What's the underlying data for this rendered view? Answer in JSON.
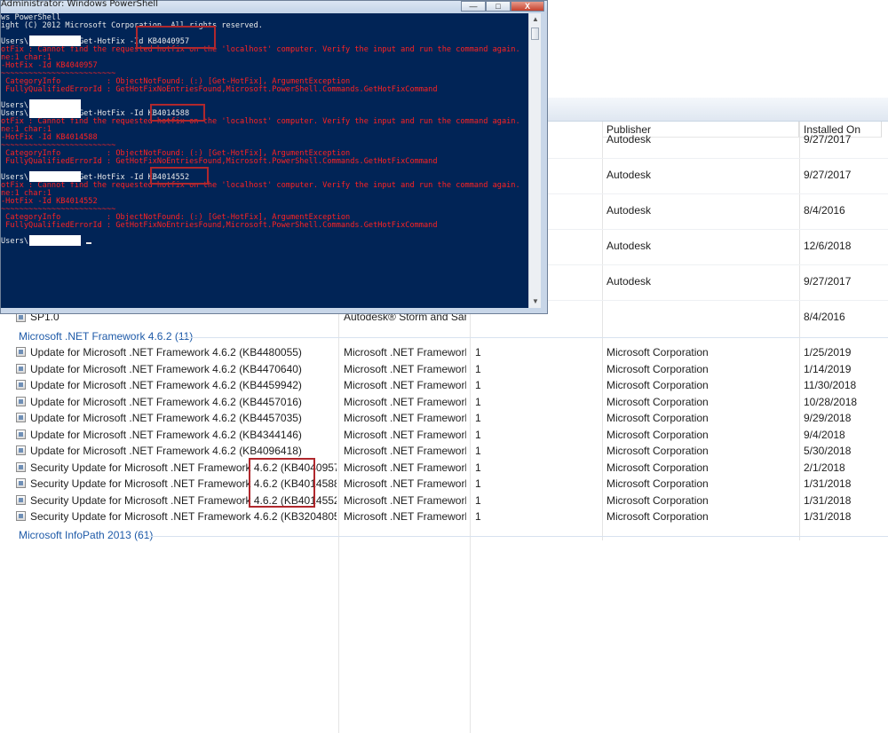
{
  "powershell": {
    "title": "Administrator: Windows PowerShell",
    "min_label": "—",
    "max_label": "□",
    "close_label": "X",
    "lines": [
      {
        "text": "ws PowerShell",
        "color": "w"
      },
      {
        "text": "ight (C) 2012 Microsoft Corporation. All rights reserved.",
        "color": "w"
      },
      {
        "text": "",
        "color": "w"
      },
      {
        "text": "Users\\           Get-HotFix -Id KB4040957",
        "color": "w"
      },
      {
        "text": "otFix : Cannot find the requested hotfix on the 'localhost' computer. Verify the input and run the command again.",
        "color": "r"
      },
      {
        "text": "ne:1 char:1",
        "color": "r"
      },
      {
        "text": "-HotFix -Id KB4040957",
        "color": "r"
      },
      {
        "text": "~~~~~~~~~~~~~~~~~~~~~~~~~",
        "color": "r"
      },
      {
        "text": " CategoryInfo          : ObjectNotFound: (:) [Get-HotFix], ArgumentException",
        "color": "r"
      },
      {
        "text": " FullyQualifiedErrorId : GetHotFixNoEntriesFound,Microsoft.PowerShell.Commands.GetHotFixCommand",
        "color": "r"
      },
      {
        "text": "",
        "color": "w"
      },
      {
        "text": "Users\\",
        "color": "w"
      },
      {
        "text": "Users\\           Get-HotFix -Id KB4014588",
        "color": "w"
      },
      {
        "text": "otFix : Cannot find the requested hotfix on the 'localhost' computer. Verify the input and run the command again.",
        "color": "r"
      },
      {
        "text": "ne:1 char:1",
        "color": "r"
      },
      {
        "text": "-HotFix -Id KB4014588",
        "color": "r"
      },
      {
        "text": "~~~~~~~~~~~~~~~~~~~~~~~~~",
        "color": "r"
      },
      {
        "text": " CategoryInfo          : ObjectNotFound: (:) [Get-HotFix], ArgumentException",
        "color": "r"
      },
      {
        "text": " FullyQualifiedErrorId : GetHotFixNoEntriesFound,Microsoft.PowerShell.Commands.GetHotFixCommand",
        "color": "r"
      },
      {
        "text": "",
        "color": "w"
      },
      {
        "text": "Users\\           Get-HotFix -Id KB4014552",
        "color": "w"
      },
      {
        "text": "otFix : Cannot find the requested hotfix on the 'localhost' computer. Verify the input and run the command again.",
        "color": "r"
      },
      {
        "text": "ne:1 char:1",
        "color": "r"
      },
      {
        "text": "-HotFix -Id KB4014552",
        "color": "r"
      },
      {
        "text": "~~~~~~~~~~~~~~~~~~~~~~~~~",
        "color": "r"
      },
      {
        "text": " CategoryInfo          : ObjectNotFound: (:) [Get-HotFix], ArgumentException",
        "color": "r"
      },
      {
        "text": " FullyQualifiedErrorId : GetHotFixNoEntriesFound,Microsoft.PowerShell.Commands.GetHotFixCommand",
        "color": "r"
      },
      {
        "text": "",
        "color": "w"
      },
      {
        "text": "Users\\",
        "color": "w"
      }
    ]
  },
  "columns": {
    "publisher": "Publisher",
    "installed_on": "Installed On"
  },
  "autodesk_rows": [
    {
      "publisher": "Autodesk",
      "installed_on": "9/27/2017"
    },
    {
      "publisher": "Autodesk",
      "installed_on": "9/27/2017"
    },
    {
      "publisher": "Autodesk",
      "installed_on": "8/4/2016"
    },
    {
      "publisher": "Autodesk",
      "installed_on": "12/6/2018"
    },
    {
      "publisher": "Autodesk",
      "installed_on": "9/27/2017"
    }
  ],
  "sp_row": {
    "name": "SP1.0",
    "program": "Autodesk® Storm and San...",
    "installed_on": "8/4/2016"
  },
  "groups": {
    "net": "Microsoft .NET Framework 4.6.2 (11)",
    "infopath": "Microsoft InfoPath 2013 (61)"
  },
  "net_rows": [
    {
      "name": "Update for Microsoft .NET Framework 4.6.2 (KB4480055)",
      "program": "Microsoft .NET Framework...",
      "version": "1",
      "publisher": "Microsoft Corporation",
      "installed_on": "1/25/2019"
    },
    {
      "name": "Update for Microsoft .NET Framework 4.6.2 (KB4470640)",
      "program": "Microsoft .NET Framework...",
      "version": "1",
      "publisher": "Microsoft Corporation",
      "installed_on": "1/14/2019"
    },
    {
      "name": "Update for Microsoft .NET Framework 4.6.2 (KB4459942)",
      "program": "Microsoft .NET Framework...",
      "version": "1",
      "publisher": "Microsoft Corporation",
      "installed_on": "11/30/2018"
    },
    {
      "name": "Update for Microsoft .NET Framework 4.6.2 (KB4457016)",
      "program": "Microsoft .NET Framework...",
      "version": "1",
      "publisher": "Microsoft Corporation",
      "installed_on": "10/28/2018"
    },
    {
      "name": "Update for Microsoft .NET Framework 4.6.2 (KB4457035)",
      "program": "Microsoft .NET Framework...",
      "version": "1",
      "publisher": "Microsoft Corporation",
      "installed_on": "9/29/2018"
    },
    {
      "name": "Update for Microsoft .NET Framework 4.6.2 (KB4344146)",
      "program": "Microsoft .NET Framework...",
      "version": "1",
      "publisher": "Microsoft Corporation",
      "installed_on": "9/4/2018"
    },
    {
      "name": "Update for Microsoft .NET Framework 4.6.2 (KB4096418)",
      "program": "Microsoft .NET Framework...",
      "version": "1",
      "publisher": "Microsoft Corporation",
      "installed_on": "5/30/2018"
    },
    {
      "name": "Security Update for Microsoft .NET Framework 4.6.2 (KB4040957)",
      "program": "Microsoft .NET Framework...",
      "version": "1",
      "publisher": "Microsoft Corporation",
      "installed_on": "2/1/2018"
    },
    {
      "name": "Security Update for Microsoft .NET Framework 4.6.2 (KB4014588)",
      "program": "Microsoft .NET Framework...",
      "version": "1",
      "publisher": "Microsoft Corporation",
      "installed_on": "1/31/2018"
    },
    {
      "name": "Security Update for Microsoft .NET Framework 4.6.2 (KB4014552)",
      "program": "Microsoft .NET Framework...",
      "version": "1",
      "publisher": "Microsoft Corporation",
      "installed_on": "1/31/2018"
    },
    {
      "name": "Security Update for Microsoft .NET Framework 4.6.2 (KB3204805)",
      "program": "Microsoft .NET Framework...",
      "version": "1",
      "publisher": "Microsoft Corporation",
      "installed_on": "1/31/2018"
    }
  ]
}
